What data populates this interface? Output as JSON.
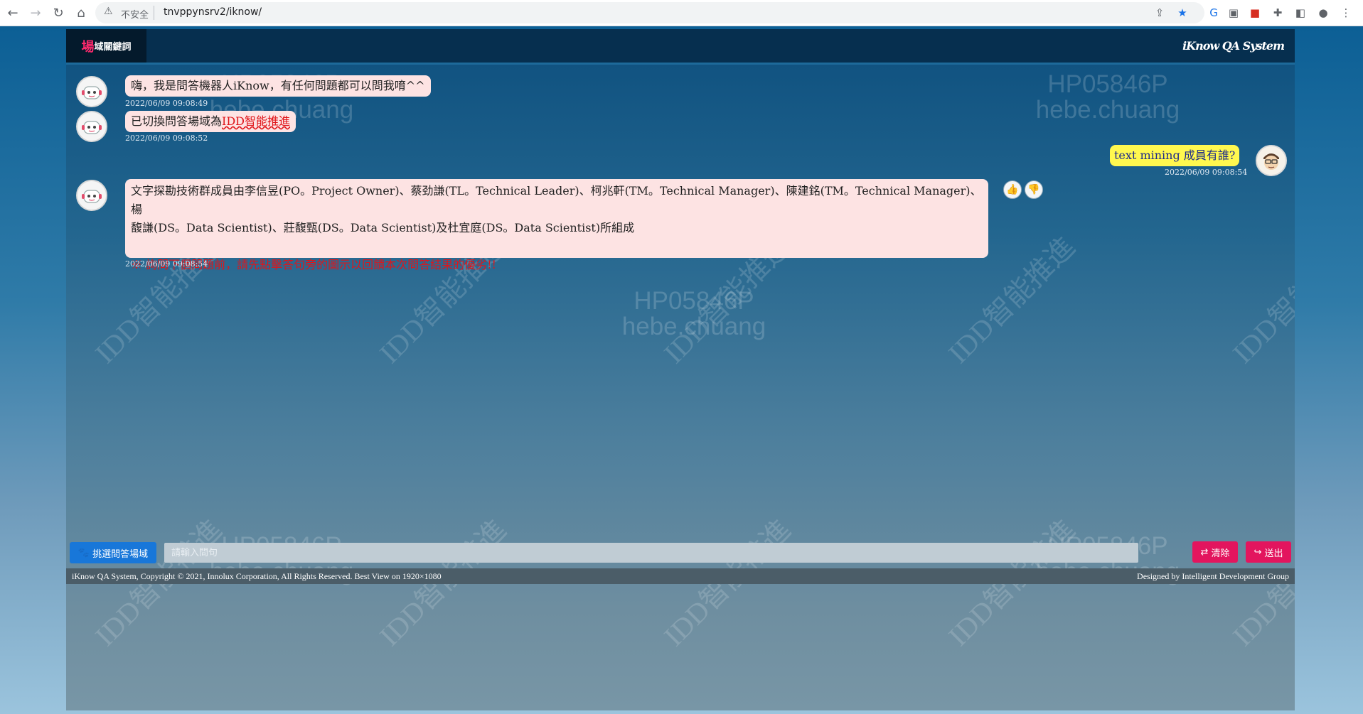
{
  "browser": {
    "security_label": "不安全",
    "url": "tnvppynsrv2/iknow/"
  },
  "header": {
    "domain_char": "場",
    "domain_rest": "域關鍵詞",
    "system_title": "iKnow QA System"
  },
  "watermarks": {
    "user_id": "HP05846P",
    "user_name": "hebe.chuang",
    "diagonal": "IDD智能推進"
  },
  "messages": [
    {
      "text": "嗨，我是問答機器人iKnow，有任何問題都可以問我唷^^",
      "time": "2022/06/09 09:08:49"
    },
    {
      "prefix": "已切換問答場域為",
      "highlight": "IDD智能推進",
      "time": "2022/06/09 09:08:52"
    },
    {
      "text": "text mining 成員有誰?",
      "time": "2022/06/09 09:08:54"
    },
    {
      "line1": "文字探勘技術群成員由李信昱(PO。Project Owner)、蔡劲謙(TL。Technical Leader)、柯兆軒(TM。Technical Manager)、陳建銘(TM。Technical Manager)、楊",
      "line2": "馥謙(DS。Data Scientist)、莊馥甄(DS。Data Scientist)及杜宜庭(DS。Data Scientist)所組成",
      "note": "※ 詢問下個問題前，請先點擊答句旁的圖示以回饋本次問答結果的優劣!!",
      "time": "2022/06/09 09:08:54"
    }
  ],
  "controls": {
    "choose_domain": "挑選問答場域",
    "input_placeholder": "請輸入問句",
    "clear": "清除",
    "send": "送出"
  },
  "footer": {
    "left": "iKnow QA System, Copyright © 2021, Innolux Corporation, All Rights Reserved. Best View on 1920×1080",
    "right": "Designed by Intelligent Development Group"
  }
}
